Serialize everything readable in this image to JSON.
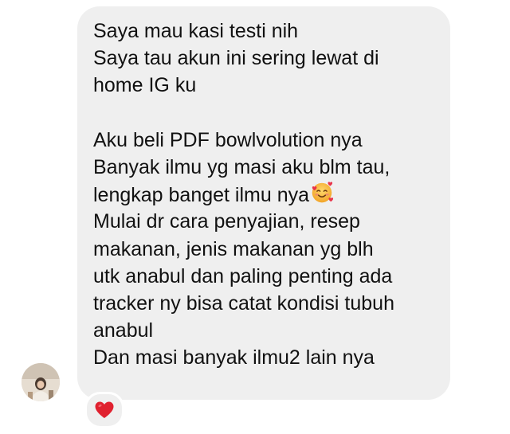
{
  "message": {
    "lines": [
      "Saya mau kasi testi nih",
      "Saya tau akun ini sering lewat di",
      "home IG ku",
      "",
      "Aku beli PDF bowlvolution nya",
      "Banyak ilmu yg masi aku blm tau,",
      "lengkap banget ilmu nya",
      "Mulai dr cara penyajian, resep",
      "makanan, jenis makanan yg blh",
      "utk anabul dan paling penting ada",
      "tracker ny bisa catat kondisi tubuh",
      "anabul",
      "Dan masi banyak ilmu2 lain nya"
    ],
    "inline_emoji": "smiling-face-with-hearts-icon"
  },
  "reaction": {
    "icon": "red-heart-icon",
    "color": "#e0212f"
  },
  "avatar": {
    "icon": "user-avatar"
  }
}
